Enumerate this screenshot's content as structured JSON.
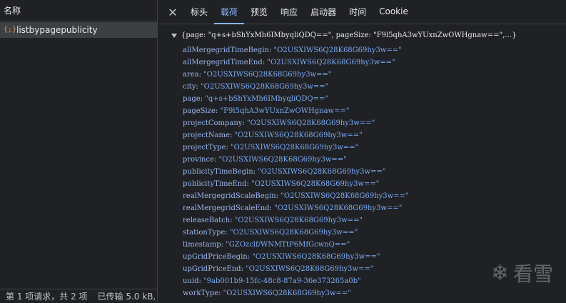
{
  "left": {
    "header": "名称",
    "request_name": "listbypagepublicity",
    "fetch_icon": "{;}",
    "status": [
      "第 1 项请求，共 2 项",
      "已传输 5.0 kB,"
    ]
  },
  "tabs": [
    "标头",
    "载荷",
    "预览",
    "响应",
    "启动器",
    "时间",
    "Cookie"
  ],
  "active_tab": "载荷",
  "payload": {
    "summary": "{page: \"q+s+bShYxMh6IMbyqliQDQ==\", pageSize: \"F9l5qhA3wYUxnZwOWHgnaw==\",…}",
    "items": [
      {
        "key": "allMergegridTimeBegin",
        "value": "\"O2USXIWS6Q28K68G69hy3w==\""
      },
      {
        "key": "allMergegridTimeEnd",
        "value": "\"O2USXIWS6Q28K68G69hy3w==\""
      },
      {
        "key": "area",
        "value": "\"O2USXIWS6Q28K68G69hy3w==\""
      },
      {
        "key": "city",
        "value": "\"O2USXIWS6Q28K68G69hy3w==\""
      },
      {
        "key": "page",
        "value": "\"q+s+bShYxMh6IMbyqliQDQ==\""
      },
      {
        "key": "pageSize",
        "value": "\"F9l5qhA3wYUxnZwOWHgnaw==\""
      },
      {
        "key": "projectCompany",
        "value": "\"O2USXIWS6Q28K68G69hy3w==\""
      },
      {
        "key": "projectName",
        "value": "\"O2USXIWS6Q28K68G69hy3w==\""
      },
      {
        "key": "projectType",
        "value": "\"O2USXIWS6Q28K68G69hy3w==\""
      },
      {
        "key": "province",
        "value": "\"O2USXIWS6Q28K68G69hy3w==\""
      },
      {
        "key": "publicityTimeBegin",
        "value": "\"O2USXIWS6Q28K68G69hy3w==\""
      },
      {
        "key": "publicityTimeEnd",
        "value": "\"O2USXIWS6Q28K68G69hy3w==\""
      },
      {
        "key": "realMergegridScaleBegin",
        "value": "\"O2USXIWS6Q28K68G69hy3w==\""
      },
      {
        "key": "realMergegridScaleEnd",
        "value": "\"O2USXIWS6Q28K68G69hy3w==\""
      },
      {
        "key": "releaseBatch",
        "value": "\"O2USXIWS6Q28K68G69hy3w==\""
      },
      {
        "key": "stationType",
        "value": "\"O2USXIWS6Q28K68G69hy3w==\""
      },
      {
        "key": "timestamp",
        "value": "\"GZOzclf/WNMTtP6MfGcwnQ==\""
      },
      {
        "key": "upGridPriceBegin",
        "value": "\"O2USXIWS6Q28K68G69hy3w==\""
      },
      {
        "key": "upGridPriceEnd",
        "value": "\"O2USXIWS6Q28K68G69hy3w==\""
      },
      {
        "key": "uuid",
        "value": "\"9ab001b9-15fc-48c8-87a9-36e373265a0b\""
      },
      {
        "key": "workType",
        "value": "\"O2USXIWS6Q28K68G69hy3w==\""
      }
    ]
  },
  "watermark": {
    "icon": "snowflake-icon",
    "text": "看雪"
  },
  "colors": {
    "accent": "#8ab4f8",
    "background": "#202124",
    "selected_row": "#3c4043"
  }
}
